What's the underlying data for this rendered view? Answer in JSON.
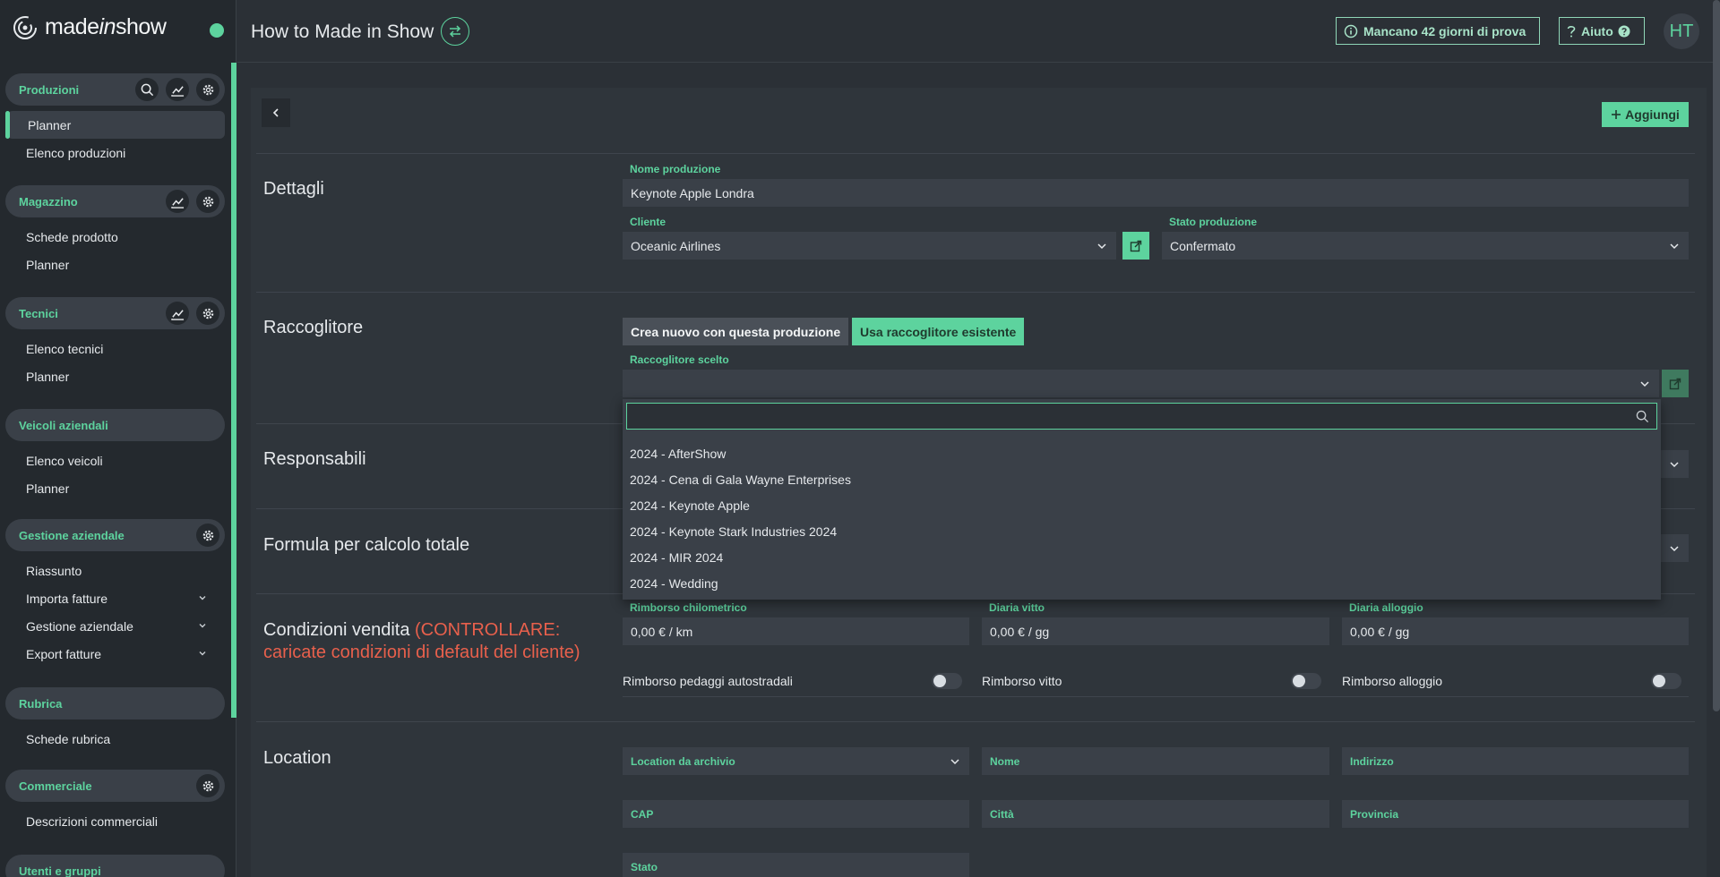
{
  "brand": {
    "logo_prefix": "made",
    "logo_italic": "in",
    "logo_suffix": "show",
    "accent": "#5dd39e",
    "warning": "#e8604c"
  },
  "sidebar": {
    "sections": [
      {
        "title": "Produzioni",
        "items": [
          "Planner",
          "Elenco produzioni"
        ]
      },
      {
        "title": "Magazzino",
        "items": [
          "Schede prodotto",
          "Planner"
        ]
      },
      {
        "title": "Tecnici",
        "items": [
          "Elenco tecnici",
          "Planner"
        ]
      },
      {
        "title": "Veicoli aziendali",
        "items": [
          "Elenco veicoli",
          "Planner"
        ]
      },
      {
        "title": "Gestione aziendale",
        "items": [
          "Riassunto",
          "Importa fatture",
          "Gestione aziendale",
          "Export fatture"
        ]
      },
      {
        "title": "Rubrica",
        "items": [
          "Schede rubrica"
        ]
      },
      {
        "title": "Commerciale",
        "items": [
          "Descrizioni commerciali"
        ]
      },
      {
        "title": "Utenti e gruppi",
        "items": []
      }
    ]
  },
  "header": {
    "title": "How to Made in Show",
    "trial": "Mancano 42 giorni di prova",
    "help": "Aiuto",
    "avatar": "HT"
  },
  "panel": {
    "add_label": "Aggiungi",
    "dettagli": {
      "title": "Dettagli",
      "nome_label": "Nome produzione",
      "nome_value": "Keynote Apple Londra",
      "cliente_label": "Cliente",
      "cliente_value": "Oceanic Airlines",
      "stato_label": "Stato produzione",
      "stato_value": "Confermato"
    },
    "raccoglitore": {
      "title": "Raccoglitore",
      "seg_new": "Crea nuovo con questa produzione",
      "seg_existing": "Usa raccoglitore esistente",
      "scelto_label": "Raccoglitore scelto",
      "search_placeholder": "",
      "options": [
        "2024 - AfterShow",
        "2024 - Cena di Gala Wayne Enterprises",
        "2024 - Keynote Apple",
        "2024 - Keynote Stark Industries 2024",
        "2024 - MIR 2024",
        "2024 - Wedding"
      ]
    },
    "responsabili": {
      "title": "Responsabili"
    },
    "formula": {
      "title": "Formula per calcolo totale"
    },
    "condizioni": {
      "title": "Condizioni vendita",
      "warning_line1": "(CONTROLLARE:",
      "warning_line2": "caricate condizioni di default del cliente)",
      "rimborso_km_label": "Rimborso chilometrico",
      "rimborso_km_value": "0,00 € / km",
      "diaria_vitto_label": "Diaria vitto",
      "diaria_vitto_value": "0,00 € / gg",
      "diaria_alloggio_label": "Diaria alloggio",
      "diaria_alloggio_value": "0,00 € / gg",
      "toggle_pedaggi": "Rimborso pedaggi autostradali",
      "toggle_vitto": "Rimborso vitto",
      "toggle_alloggio": "Rimborso alloggio"
    },
    "location": {
      "title": "Location",
      "archivio": "Location da archivio",
      "nome": "Nome",
      "indirizzo": "Indirizzo",
      "cap": "CAP",
      "citta": "Città",
      "provincia": "Provincia",
      "stato": "Stato"
    }
  }
}
